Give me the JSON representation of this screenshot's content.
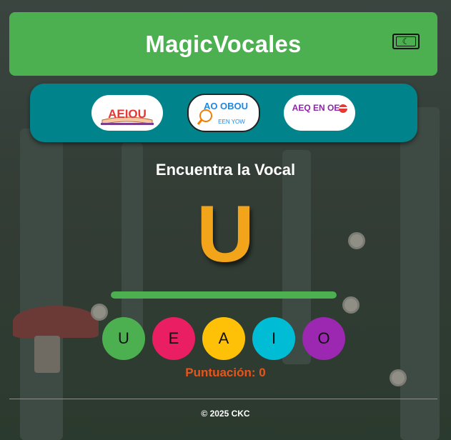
{
  "app": {
    "title": "MagicVocales",
    "theme_toggle_icon": "moon-icon"
  },
  "modes": [
    {
      "name": "mode-vowels-book",
      "text": "AEIOU",
      "colors": [
        "#e53935",
        "#fbc02d",
        "#43a047",
        "#1e88e5",
        "#8e24aa"
      ]
    },
    {
      "name": "mode-find-vowel",
      "text": "AO OBOU",
      "subtext": "EEN YOW",
      "colors": [
        "#e53935",
        "#1e88e5",
        "#fbc02d",
        "#43a047"
      ]
    },
    {
      "name": "mode-vowels-flag",
      "text": "AEQ EN OE",
      "colors": [
        "#e53935",
        "#1e88e5",
        "#fbc02d",
        "#8e24aa"
      ]
    }
  ],
  "game": {
    "section_title": "Encuentra la Vocal",
    "target_letter": "U",
    "progress": 1.0,
    "options": [
      {
        "letter": "U",
        "color": "#4caf50"
      },
      {
        "letter": "E",
        "color": "#e91e63"
      },
      {
        "letter": "A",
        "color": "#ffc107"
      },
      {
        "letter": "I",
        "color": "#00bcd4"
      },
      {
        "letter": "O",
        "color": "#9c27b0"
      }
    ],
    "score_text": "Puntuación: 0"
  },
  "footer": {
    "text": "© 2025 CKC"
  }
}
